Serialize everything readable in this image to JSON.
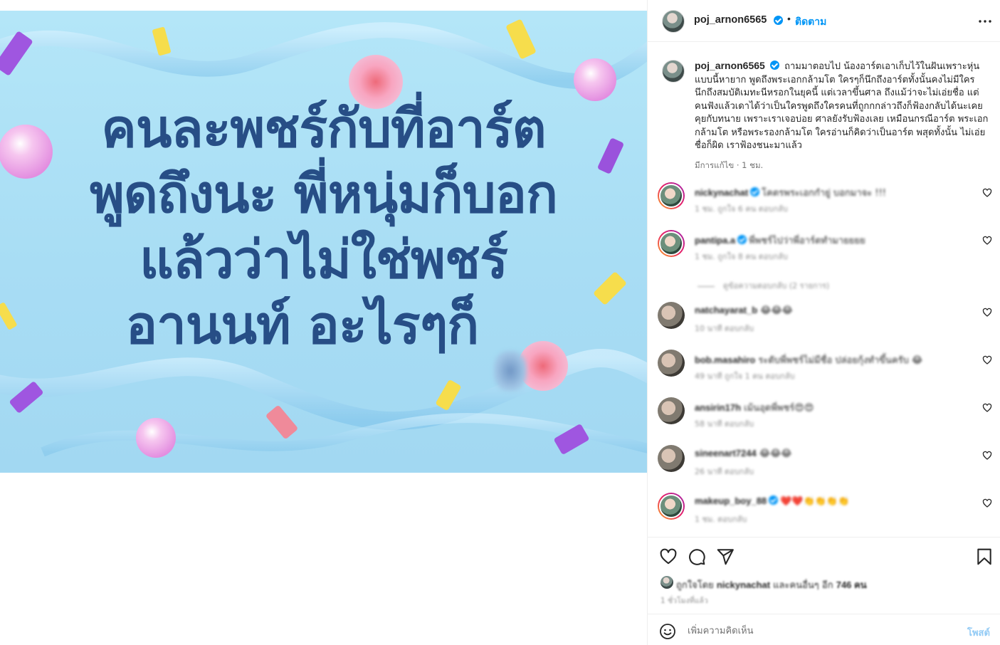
{
  "image": {
    "headline_lines": [
      "คนละพชร์กับที่อาร์ต",
      "พูดถึงนะ พี่หนุ่มก็บอก",
      "แล้วว่าไม่ใช่พชร์",
      "อานนท์ อะไรๆก็"
    ],
    "colors": {
      "background": "#aee0f6",
      "text": "#274e86"
    }
  },
  "header": {
    "username": "poj_arnon6565",
    "separator": "•",
    "follow_label": "ติดตาม",
    "more_icon": "more-horizontal-icon"
  },
  "caption": {
    "username": "poj_arnon6565",
    "text": "ถามมาตอบไป น้องอาร์ตเอาเก็บไว้ในฝันเพราะหุ่นแบบนี้หายาก พูดถึงพระเอกกล้ามโต ใครๆก็นึกถึงอาร์ตทั้งนั้นคงไม่มีใครนึกถึงสมบัติเมทะนีหรอกในยุคนี้ แต่เวลาขึ้นศาล ถึงแม้ว่าจะไม่เอ่ยชื่อ แต่คนฟังแล้วเดาได้ว่าเป็นใครพูดถึงใครคนที่ถูกกกล่าวถึงก็ฟ้องกลับได้นะเคยคุยกับทนาย เพราะเราเจอบ่อย ศาลยังรับฟ้องเลย เหมือนกรณีอาร์ต พระเอกกล้ามโต หรือพระรองกล้ามโต ใครอ่านก็คิดว่าเป็นอาร์ต พสุดทั้งนั้น ไม่เอ่ยชื่อก็ผิด เราฟ้องชนะมาแล้ว",
    "meta": "มีการแก้ไข · 1 ชม."
  },
  "comments": [
    {
      "username": "nickynachat",
      "verified": true,
      "text": "โคตรพระเอกกำยู่ บอกมาจะ !!!",
      "meta": "1 ชม.   ถูกใจ 6 คน   ตอบกลับ",
      "ring": true
    },
    {
      "username": "pantipa.a",
      "verified": true,
      "text": "พี่พชร์ไปว่าพี่อาร์ตทำมายยยย",
      "meta": "1 ชม.   ถูกใจ 8 คน   ตอบกลับ",
      "ring": true
    },
    {
      "username": "natchayarat_b",
      "verified": false,
      "text": "😂😂😂",
      "meta": "10 นาที   ตอบกลับ",
      "ring": false
    },
    {
      "username": "bob.masahiro",
      "verified": false,
      "text": "ระดับพี่พชร์ไม่มีชื่อ ปล่อยกุ้งทำขึ้นครับ 😂",
      "meta": "49 นาที   ถูกใจ 1 คน   ตอบกลับ",
      "ring": false
    },
    {
      "username": "ansirin17h",
      "verified": false,
      "text": "เม้นอุดพี่พชร์😍😍",
      "meta": "58 นาที   ตอบกลับ",
      "ring": false
    },
    {
      "username": "sineenart7244",
      "verified": false,
      "text": "😂😂😂",
      "meta": "26 นาที   ตอบกลับ",
      "ring": false
    },
    {
      "username": "makeup_boy_88",
      "verified": true,
      "text": "❤️❤️👏👏👏👏",
      "meta": "1 ชม.   ตอบกลับ",
      "ring": true
    }
  ],
  "view_replies": "ดูข้อความตอบกลับ (2 รายการ)",
  "actions": {
    "like_icon": "heart-icon",
    "comment_icon": "comment-icon",
    "share_icon": "share-icon",
    "save_icon": "bookmark-icon"
  },
  "likes": {
    "prefix": "ถูกใจโดย ",
    "user": "nickynachat",
    "middle": " และคนอื่นๆ อีก ",
    "count": "746 คน"
  },
  "post_time": "1 ชั่วโมงที่แล้ว",
  "comment_bar": {
    "emoji_icon": "smiley-icon",
    "placeholder": "เพิ่มความคิดเห็น",
    "post_label": "โพสต์"
  }
}
